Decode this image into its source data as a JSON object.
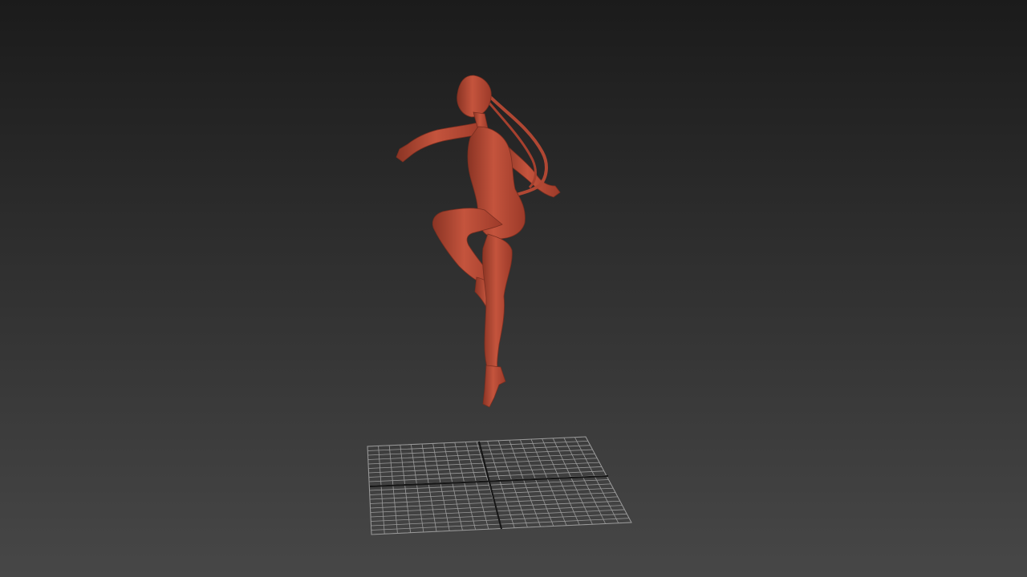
{
  "viewport": {
    "background_top": "#1b1b1b",
    "background_bottom": "#474747"
  },
  "figure": {
    "icon": "animated-character-model",
    "color": "#b84a36",
    "highlight": "#cf6a52",
    "shadow": "#8a3424"
  },
  "ground_grid": {
    "icon": "ground-plane-grid",
    "line_color": "#9a9a9a",
    "axis_color": "#1a1a1a"
  }
}
